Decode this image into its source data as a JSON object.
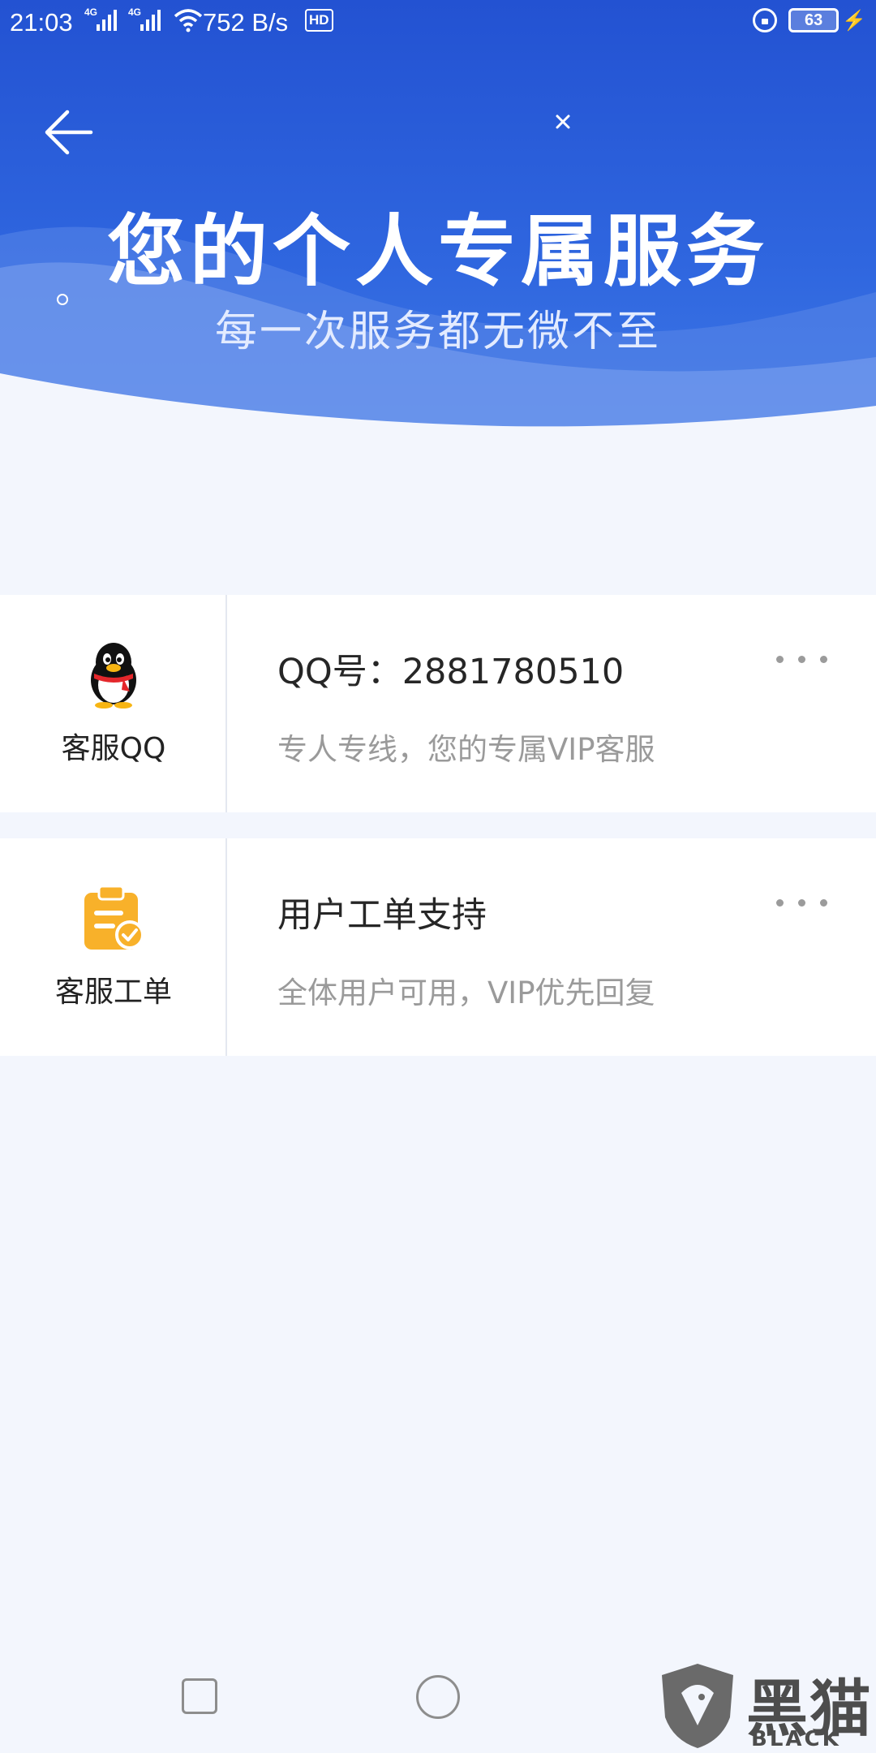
{
  "status_bar": {
    "time": "21:03",
    "network_type_1": "4G",
    "network_type_2": "4G",
    "speed": "752 B/s",
    "hd_badge": "HD",
    "battery_level": "63"
  },
  "banner": {
    "title": "您的个人专属服务",
    "subtitle": "每一次服务都无微不至"
  },
  "services": [
    {
      "icon": "qq-penguin-icon",
      "label": "客服QQ",
      "title": "QQ号：2881780510",
      "description": "专人专线，您的专属VIP客服"
    },
    {
      "icon": "clipboard-check-icon",
      "label": "客服工单",
      "title": "用户工单支持",
      "description": "全体用户可用，VIP优先回复"
    }
  ],
  "watermark": {
    "cn": "黑猫",
    "en": "BLACK CAT"
  },
  "colors": {
    "header_blue": "#2352d2",
    "page_bg": "#f3f6fd",
    "ticket_icon": "#f8b12a"
  }
}
